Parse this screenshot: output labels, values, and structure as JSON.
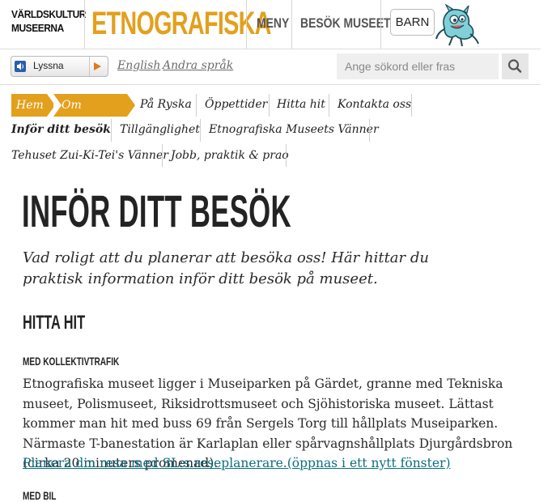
{
  "header": {
    "logo_vk_line1": "VÄRLDSKULTUR",
    "logo_vk_line2": "MUSEERNA",
    "logo_etno": "ETNOGRAFISKA",
    "menu_label": "MENY",
    "visit_label": "BESÖK MUSEET",
    "barn_label": "BARN"
  },
  "toolbar": {
    "lyssna_label": "Lyssna",
    "english_label": "English",
    "other_langs_label": "Andra språk",
    "search_placeholder": "Ange sökord eller fras"
  },
  "nav": {
    "home": "Hem",
    "om_museet": "Om Museet",
    "pa_ryska": "På Ryska",
    "oppettider": "Öppettider",
    "hitta_hit": "Hitta hit",
    "kontakta_oss": "Kontakta oss",
    "infor_ditt_besok": "Inför ditt besök",
    "tillganglighet": "Tillgänglighet",
    "vanner": "Etnografiska Museets Vänner",
    "tehuset": "Tehuset Zui-Ki-Tei's Vänner",
    "jobb": "Jobb, praktik & prao"
  },
  "content": {
    "title": "INFÖR DITT BESÖK",
    "intro": "Vad roligt att du planerar att besöka oss! Här hittar du praktisk information inför ditt besök på museet.",
    "section_heading": "HITTA HIT",
    "subheading": "MED KOLLEKTIVTRAFIK",
    "paragraph": "Etnografiska museet ligger i Museiparken på Gärdet, granne med Tekniska museet, Polismuseet, Riksidrottsmuseet och Sjöhistoriska museet. Lättast kommer man hit med buss 69 från Sergels Torg till hållplats Museiparken. Närmaste T-banestation är Karlaplan eller spårvagnshållplats Djurgårdsbron (cirka 20 minuters promenad).",
    "plan_link": "Planera din resa med SL:s reseplanerare.(öppnas i ett nytt fönster)",
    "cut_heading": "MED BIL"
  },
  "icons": {
    "speaker": "speaker-icon",
    "play": "play-icon",
    "search": "search-icon",
    "mascot": "mascot-icon"
  },
  "colors": {
    "accent": "#e3a01c",
    "link": "#0c6f7e",
    "play": "#e07a1a"
  }
}
